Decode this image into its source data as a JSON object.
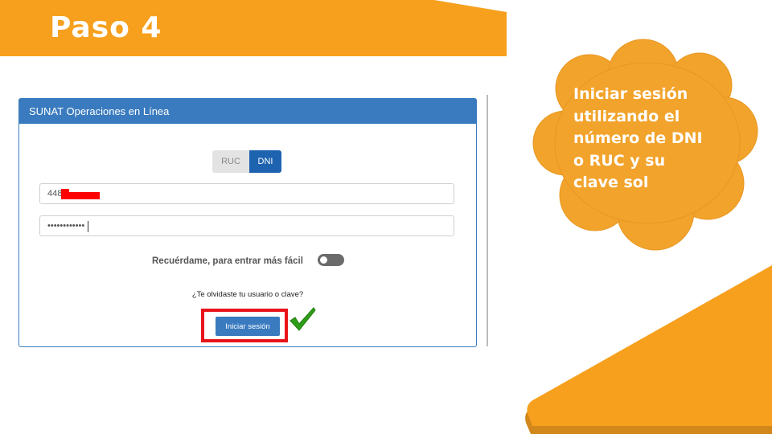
{
  "slide": {
    "title": "Paso 4",
    "callout": "Iniciar sesión utilizando el número de DNI o RUC y su clave sol"
  },
  "login_panel": {
    "header": "SUNAT Operaciones en Línea",
    "doc_types": {
      "ruc": "RUC",
      "dni": "DNI",
      "selected": "DNI"
    },
    "username_value": "448",
    "password_value": "••••••••••••",
    "remember_label": "Recuérdame, para entrar más fácil",
    "remember_enabled": false,
    "forgot_link": "¿Te olvidaste tu usuario o clave?",
    "login_button": "Iniciar sesión"
  },
  "colors": {
    "orange": "#f7a01e",
    "cloud": "#f2a32b",
    "panel_blue": "#3a7bbf",
    "dni_blue": "#1e63b0",
    "highlight_red": "#e8141a",
    "check_green": "#2e9e18"
  },
  "icons": {
    "checkmark": "green-check-icon",
    "toggle": "toggle-switch-icon"
  }
}
